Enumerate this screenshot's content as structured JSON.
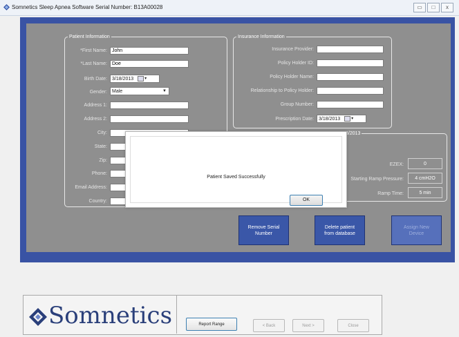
{
  "window": {
    "title": "Somnetics Sleep Apnea Software   Serial Number: B13A00028",
    "min_symbol": "▭",
    "max_symbol": "□",
    "close_symbol": "x"
  },
  "patient": {
    "legend": "Patient Information",
    "labels": {
      "first_name": "*First Name:",
      "last_name": "*Last Name:",
      "birth_date": "Birth Date:",
      "gender": "Gender:",
      "address1": "Address 1:",
      "address2": "Address 2:",
      "city": "City:",
      "state": "State:",
      "zip": "Zip:",
      "phone": "Phone:",
      "email": "Email Address:",
      "country": "Country:"
    },
    "values": {
      "first_name": "John",
      "last_name": "Doe",
      "birth_date": "3/18/2013",
      "gender": "Male"
    }
  },
  "insurance": {
    "legend": "Insurance Information",
    "labels": {
      "provider": "Insurance Provider:",
      "policy_id": "Policy Holder ID:",
      "policy_name": "Policy Holder Name:",
      "relationship": "Relationship to Policy Holder:",
      "group_number": "Group Number:",
      "prescription_date": "Prescription Date:"
    },
    "values": {
      "prescription_date": "3/18/2013"
    }
  },
  "device": {
    "legend_partial": "8/2013",
    "labels": {
      "ezex": "EZEX:",
      "ramp_pressure": "Starting Ramp Pressure:",
      "ramp_time": "Ramp Time:"
    },
    "values": {
      "ezex": "0",
      "ramp_pressure": "4 cmH2O",
      "ramp_time": "5 min"
    }
  },
  "actions": {
    "remove_serial": "Remove Serial Number",
    "delete_patient": "Delete patient from database",
    "assign_device": "Assign New Device"
  },
  "dialog": {
    "message": "Patient Saved Successfully",
    "ok": "OK"
  },
  "footer": {
    "logo_text": "Somnetics",
    "report_range": "Report Range",
    "back": "< Back",
    "next": "Next >",
    "close": "Close"
  },
  "colors": {
    "blue_area": "#3953a4",
    "gray_panel": "#8f8f8f",
    "logo": "#2a3f7a"
  }
}
